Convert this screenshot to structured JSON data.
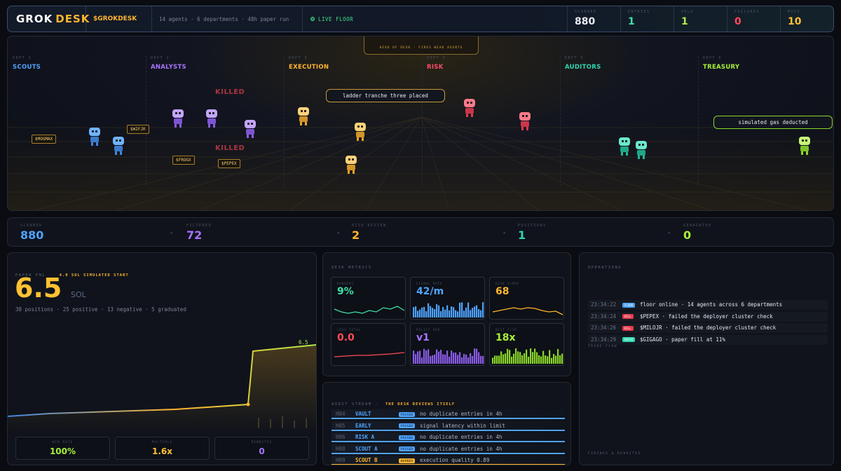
{
  "header": {
    "brand_a": "GROK",
    "brand_b": "DESK",
    "ticker": "$GROKDESK",
    "summary": "14 agents · 6 departments · 48h paper run",
    "status": "LIVE FLOOR",
    "kpis": [
      {
        "label": "SCANNED",
        "value": "880",
        "color": "#e8ecf2"
      },
      {
        "label": "ENTRIES",
        "value": "1",
        "color": "#3ee0a8"
      },
      {
        "label": "HELD",
        "value": "1",
        "color": "#b4ea4a"
      },
      {
        "label": "FAILURES",
        "value": "0",
        "color": "#ff4a5a"
      },
      {
        "label": "MODE",
        "value": "10",
        "color": "#ffc132"
      }
    ]
  },
  "floor": {
    "head_banner": "HEAD OF DESK · FIRES WEAK AGENTS",
    "departments": [
      {
        "num": "DEPT 1",
        "title": "SCOUTS",
        "color": "#4ea3ff"
      },
      {
        "num": "DEPT 2",
        "title": "ANALYSTS",
        "color": "#a774ff"
      },
      {
        "num": "DEPT 3",
        "title": "EXECUTION",
        "color": "#ffb52e"
      },
      {
        "num": "DEPT 4",
        "title": "RISK",
        "color": "#ff4a6a"
      },
      {
        "num": "DEPT 5",
        "title": "AUDITORS",
        "color": "#2fd6b0"
      },
      {
        "num": "DEPT 6",
        "title": "TREASURY",
        "color": "#a7f03a"
      }
    ],
    "token_tags": [
      "$MOGMAX",
      "$WIFJR",
      "$FROGX",
      "$PEPEX"
    ],
    "killed_labels": [
      "KILLED",
      "KILLED"
    ],
    "bubbles": [
      "ladder tranche three placed",
      "simulated gas deducted"
    ]
  },
  "pipeline": [
    {
      "label": "SCANNED",
      "value": "880",
      "color": "#4ea3ff"
    },
    {
      "label": "FILTERED",
      "value": "72",
      "color": "#a774ff"
    },
    {
      "label": "RISK REVIEW",
      "value": "2",
      "color": "#ffb52e"
    },
    {
      "label": "POSITIONS",
      "value": "1",
      "color": "#2fd6b0"
    },
    {
      "label": "GRADUATED",
      "value": "0",
      "color": "#a7f03a"
    }
  ],
  "pnl": {
    "label": "PAPER PNL ·",
    "start_note": "4.0 SOL SIMULATED START",
    "value": "6.5",
    "unit": "SOL",
    "breakdown": "38 positions · 25 positive · 13 negative · 5 graduated",
    "end_label": "6.5",
    "stats": [
      {
        "label": "WIN RATE",
        "value": "100%",
        "color": "#a7f03a"
      },
      {
        "label": "MULTIPLE",
        "value": "1.6x",
        "color": "#ffc132"
      },
      {
        "label": "REWRITES",
        "value": "0",
        "color": "#a774ff"
      }
    ]
  },
  "metrics": {
    "title": "DESK METRICS",
    "cards": [
      {
        "label": "RUNNERS",
        "value": "9%",
        "color": "#3ee0a8"
      },
      {
        "label": "SIGNAL RATE",
        "value": "42/m",
        "color": "#4ea3ff"
      },
      {
        "label": "DESK SCORE",
        "value": "68",
        "color": "#ffb52e"
      },
      {
        "label": "LOSS TOTAL",
        "value": "0.0",
        "color": "#ff4a5a"
      },
      {
        "label": "POLICY VER",
        "value": "v1",
        "color": "#a774ff"
      },
      {
        "label": "BEST FLIP",
        "value": "18x",
        "color": "#a7f03a"
      }
    ]
  },
  "audit": {
    "title": "AUDIT STREAM ·",
    "subtitle": "THE DESK REVIEWS ITSELF",
    "rows": [
      {
        "id": "H04",
        "agent": "VAULT",
        "status": "PASSED",
        "text": "no duplicate entries in 4h",
        "color": "#4ea3ff"
      },
      {
        "id": "H05",
        "agent": "EARLY",
        "status": "PASSED",
        "text": "signal latency within limit",
        "color": "#4ea3ff"
      },
      {
        "id": "H06",
        "agent": "RISK A",
        "status": "PASSED",
        "text": "no duplicate entries in 4h",
        "color": "#4ea3ff"
      },
      {
        "id": "H08",
        "agent": "SCOUT A",
        "status": "PASSED",
        "text": "no duplicate entries in 4h",
        "color": "#4ea3ff"
      },
      {
        "id": "H09",
        "agent": "SCOUT B",
        "status": "WARNED",
        "text": "execution quality 0.89",
        "color": "#ffb52e"
      }
    ]
  },
  "operations": {
    "title": "OPERATIONS",
    "rows": [
      {
        "time": "23:34:22",
        "tag": "FLOOR",
        "text": "floor online · 14 agents across 6 departments",
        "color": "#4ea3ff"
      },
      {
        "time": "23:34:24",
        "tag": "KILL",
        "text": "$PEPEX · failed the deployer cluster check",
        "color": "#e5394b"
      },
      {
        "time": "23:34:26",
        "tag": "KILL",
        "text": "$MILOJR · failed the deployer cluster check",
        "color": "#e5394b"
      },
      {
        "time": "23:34:29",
        "tag": "ENTER",
        "text": "$GIGAGO · paper fill at 11%",
        "color": "#2fd6b0"
      }
    ],
    "trade_flow": "TRADE FLOW",
    "footer": "FIRINGS & REWRITES"
  }
}
